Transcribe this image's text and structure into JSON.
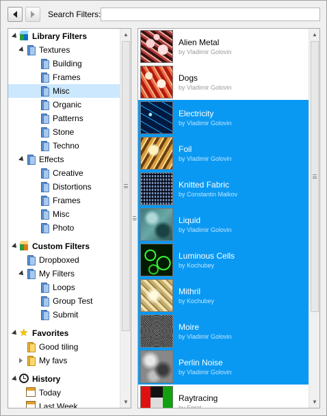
{
  "toolbar": {
    "back_icon": "arrow-left-icon",
    "forward_icon": "arrow-right-icon",
    "search_label": "Search Filters:",
    "search_value": "",
    "search_placeholder": ""
  },
  "tree": {
    "items": [
      {
        "label": "Library Filters",
        "icon": "library-cube-icon",
        "section": true
      },
      {
        "label": "Textures",
        "icon": "folder-icon"
      },
      {
        "label": "Building",
        "icon": "folder-icon"
      },
      {
        "label": "Frames",
        "icon": "folder-icon"
      },
      {
        "label": "Misc",
        "icon": "folder-icon",
        "selected": true
      },
      {
        "label": "Organic",
        "icon": "folder-icon"
      },
      {
        "label": "Patterns",
        "icon": "folder-icon"
      },
      {
        "label": "Stone",
        "icon": "folder-icon"
      },
      {
        "label": "Techno",
        "icon": "folder-icon"
      },
      {
        "label": "Effects",
        "icon": "folder-icon"
      },
      {
        "label": "Creative",
        "icon": "folder-icon"
      },
      {
        "label": "Distortions",
        "icon": "folder-icon"
      },
      {
        "label": "Frames",
        "icon": "folder-icon"
      },
      {
        "label": "Misc",
        "icon": "folder-icon"
      },
      {
        "label": "Photo",
        "icon": "folder-icon"
      },
      {
        "label": "Custom Filters",
        "icon": "custom-cube-icon",
        "section": true
      },
      {
        "label": "Dropboxed",
        "icon": "folder-icon"
      },
      {
        "label": "My Filters",
        "icon": "folder-icon"
      },
      {
        "label": "Loops",
        "icon": "folder-icon"
      },
      {
        "label": "Group Test",
        "icon": "folder-icon"
      },
      {
        "label": "Submit",
        "icon": "folder-icon"
      },
      {
        "label": "Favorites",
        "icon": "star-icon",
        "section": true
      },
      {
        "label": "Good tiling",
        "icon": "favorite-folder-icon"
      },
      {
        "label": "My favs",
        "icon": "favorite-folder-icon"
      },
      {
        "label": "History",
        "icon": "clock-icon",
        "section": true
      },
      {
        "label": "Today",
        "icon": "calendar-icon"
      },
      {
        "label": "Last Week",
        "icon": "calendar-icon"
      }
    ]
  },
  "filters": {
    "items": [
      {
        "name": "Alien Metal",
        "author": "by Vladimir Golovin",
        "selected": false
      },
      {
        "name": "Dogs",
        "author": "by Vladimir Golovin",
        "selected": false
      },
      {
        "name": "Electricity",
        "author": "by Vladimir Golovin",
        "selected": true
      },
      {
        "name": "Foil",
        "author": "by Vladimir Golovin",
        "selected": true
      },
      {
        "name": "Knitted Fabric",
        "author": "by Constantin Malkov",
        "selected": true
      },
      {
        "name": "Liquid",
        "author": "by Vladimir Golovin",
        "selected": true
      },
      {
        "name": "Luminous Cells",
        "author": "by Kochubey",
        "selected": true
      },
      {
        "name": "Mithril",
        "author": "by Kochubey",
        "selected": true
      },
      {
        "name": "Moire",
        "author": "by Vladimir Golovin",
        "selected": true
      },
      {
        "name": "Perlin Noise",
        "author": "by Vladimir Golovin",
        "selected": true
      },
      {
        "name": "Raytracing",
        "author": "by Egret",
        "selected": false
      }
    ]
  },
  "colors": {
    "selection": "#0a99f2",
    "tree_selection": "#cce8ff"
  }
}
